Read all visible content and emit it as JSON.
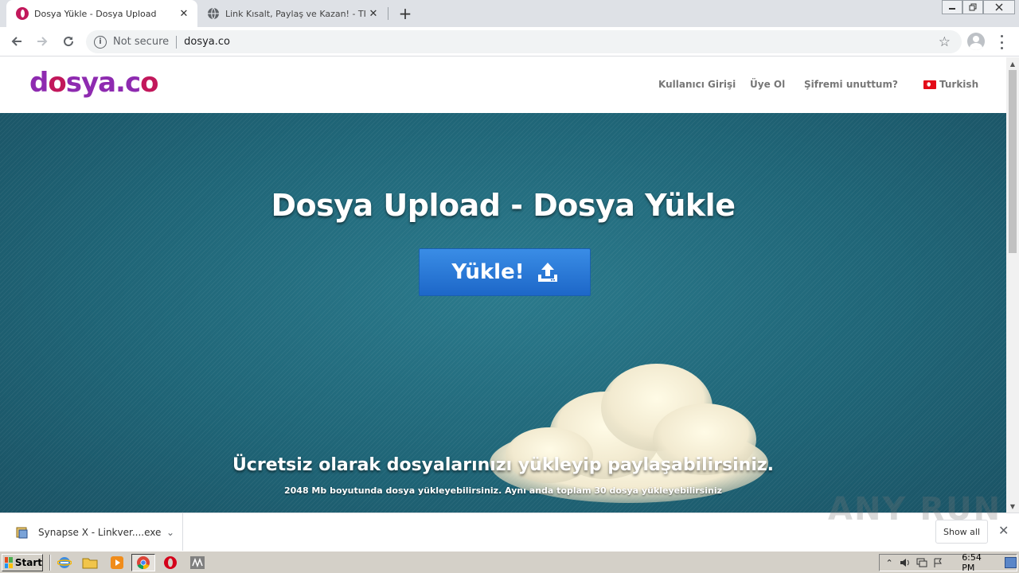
{
  "browser": {
    "tabs": [
      {
        "title": "Dosya Yükle - Dosya Upload",
        "close": "✕"
      },
      {
        "title": "Link Kısalt, Paylaş ve Kazan! - TIK.LA",
        "close": "✕"
      }
    ],
    "new_tab": "+",
    "address": {
      "security_label": "Not secure",
      "url": "dosya.co"
    }
  },
  "site": {
    "logo": {
      "part1": "d",
      "part2": "o",
      "part3": "sya.c",
      "part4": "o"
    },
    "nav": {
      "login": "Kullanıcı Girişi",
      "register": "Üye Ol",
      "forgot": "Şifremi unuttum?",
      "language": "Turkish"
    },
    "hero": {
      "title": "Dosya Upload - Dosya Yükle",
      "upload_button": "Yükle!",
      "subtitle": "Ücretsiz olarak dosyalarınızı yükleyip paylaşabilirsiniz.",
      "note": "2048 Mb boyutunda dosya yükleyebilirsiniz. Aynı anda toplam 30 dosya yükleyebilirsiniz"
    }
  },
  "downloads": {
    "item": "Synapse X - Linkver....exe",
    "show_all": "Show all",
    "watermark": "ANY RUN"
  },
  "taskbar": {
    "start": "Start",
    "clock": "6:54 PM"
  },
  "colors": {
    "logo_purple": "#8e2bb0",
    "hero_teal": "#1f6577",
    "button_blue": "#2a7ad8"
  }
}
